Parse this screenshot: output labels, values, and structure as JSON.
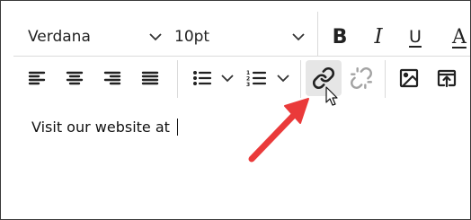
{
  "toolbar": {
    "font_family": {
      "value": "Verdana",
      "icon": "chevron-down-icon"
    },
    "font_size": {
      "value": "10pt",
      "icon": "chevron-down-icon"
    },
    "format": {
      "bold": "B",
      "italic": "I",
      "underline": "U",
      "clipped": "A"
    },
    "buttons": {
      "align_left": "align-left-icon",
      "align_center": "align-center-icon",
      "align_right": "align-right-icon",
      "justify": "align-justify-icon",
      "bulleted_list": "bulleted-list-icon",
      "numbered_list": "numbered-list-icon",
      "insert_link": "link-icon",
      "remove_link": "unlink-icon",
      "insert_image": "image-icon",
      "insert_embed": "embed-icon"
    },
    "numbered_list_digits": [
      "1",
      "2",
      "3"
    ],
    "active_button": "insert_link"
  },
  "editor": {
    "text": "Visit our website at "
  },
  "annotation": {
    "arrow_color": "#ea3a3a",
    "cursor": "mouse-pointer-icon"
  }
}
